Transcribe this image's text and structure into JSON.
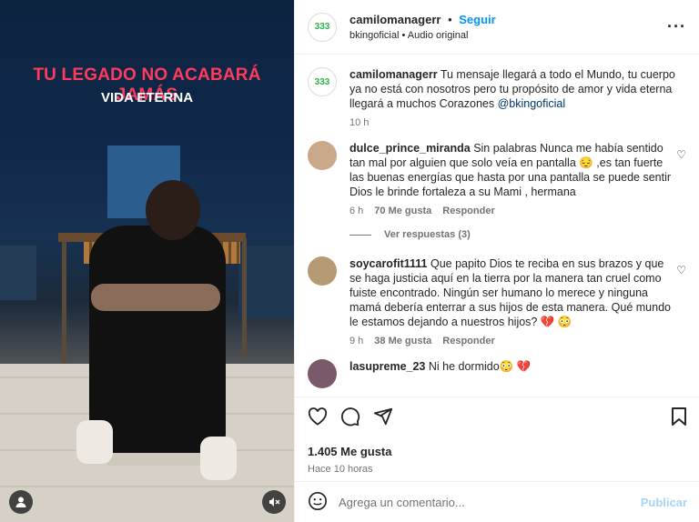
{
  "media": {
    "headline": "TU LEGADO NO ACABARÁ JAMÁS",
    "subheadline": "VIDA ETERNA"
  },
  "header": {
    "username": "camilomanagerr",
    "separator": "•",
    "follow_label": "Seguir",
    "audio_artist": "bkingoficial",
    "audio_sep": "•",
    "audio_label": "Audio original",
    "avatar_text": "333"
  },
  "caption": {
    "username": "camilomanagerr",
    "text": "Tu mensaje llegará a todo el Mundo, tu cuerpo ya no está con nosotros pero tu propósito de amor y vida eterna llegará a muchos Corazones ",
    "mention": "@bkingoficial",
    "time": "10 h"
  },
  "comments": [
    {
      "username": "dulce_prince_miranda",
      "text": "Sin palabras Nunca me había sentido tan mal por alguien que solo veía en pantalla 😔 ,es tan fuerte las buenas energías que hasta por una pantalla se puede sentir Dios le brinde fortaleza a su Mami , hermana",
      "time": "6 h",
      "likes": "70 Me gusta",
      "reply": "Responder",
      "view_replies": "Ver respuestas (3)"
    },
    {
      "username": "soycarofit1111",
      "text": "Que papito Dios te reciba en sus brazos y que se haga justicia aquí en la tierra por la manera tan cruel como fuiste encontrado. Ningún ser humano lo merece y ninguna mamá debería enterrar a sus hijos de esta manera. Qué mundo le estamos dejando a nuestros hijos? 💔 😳",
      "time": "9 h",
      "likes": "38 Me gusta",
      "reply": "Responder"
    },
    {
      "username": "lasupreme_23",
      "text": "Ni he dormido😳 💔"
    }
  ],
  "footer": {
    "likes": "1.405 Me gusta",
    "posted": "Hace 10 horas",
    "comment_placeholder": "Agrega un comentario...",
    "publish_label": "Publicar"
  },
  "icons": {
    "heart": "heart-icon",
    "comment": "comment-icon",
    "share": "share-icon",
    "save": "bookmark-icon",
    "emoji": "emoji-icon",
    "more": "more-options-icon",
    "user": "user-tag-icon",
    "mute": "muted-icon"
  }
}
